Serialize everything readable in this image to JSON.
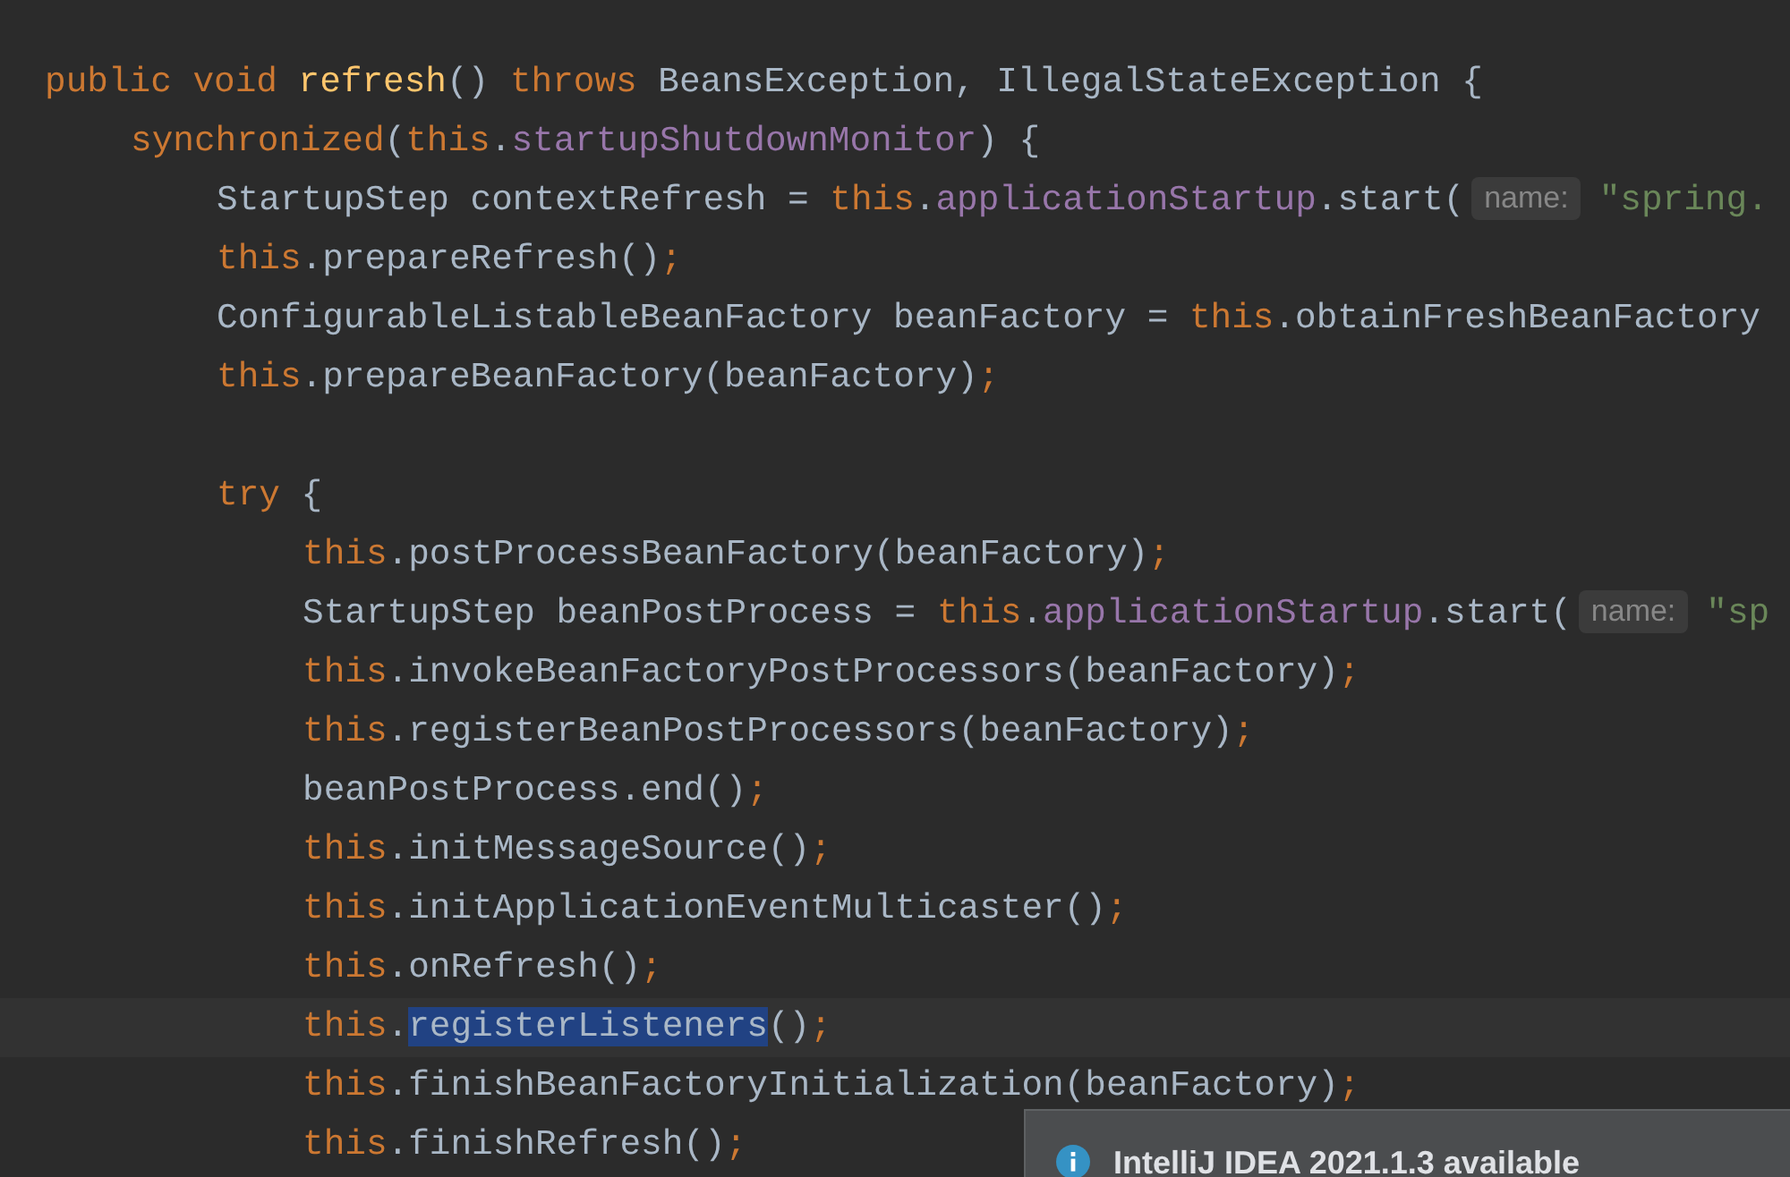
{
  "editor": {
    "lines": [
      {
        "kind": "code",
        "tokens": [
          {
            "kind": "kw",
            "text": "public void "
          },
          {
            "kind": "decl",
            "text": "refresh"
          },
          {
            "kind": "plain",
            "text": "() "
          },
          {
            "kind": "kw",
            "text": "throws"
          },
          {
            "kind": "plain",
            "text": " BeansException, IllegalStateException {"
          }
        ],
        "children": [
          {
            "kind": "code",
            "tokens": [
              {
                "kind": "kw",
                "text": "synchronized"
              },
              {
                "kind": "plain",
                "text": "("
              },
              {
                "kind": "kw",
                "text": "this"
              },
              {
                "kind": "plain",
                "text": "."
              },
              {
                "kind": "field",
                "text": "startupShutdownMonitor"
              },
              {
                "kind": "plain",
                "text": ") {"
              }
            ],
            "children": [
              {
                "kind": "code",
                "tokens": [
                  {
                    "kind": "plain",
                    "text": "StartupStep contextRefresh = "
                  },
                  {
                    "kind": "kw",
                    "text": "this"
                  },
                  {
                    "kind": "plain",
                    "text": "."
                  },
                  {
                    "kind": "field",
                    "text": "applicationStartup"
                  },
                  {
                    "kind": "plain",
                    "text": ".start("
                  },
                  {
                    "kind": "hint",
                    "text": "name:"
                  },
                  {
                    "kind": "str",
                    "text": "\"spring."
                  }
                ]
              },
              {
                "kind": "code",
                "tokens": [
                  {
                    "kind": "kw",
                    "text": "this"
                  },
                  {
                    "kind": "plain",
                    "text": ".prepareRefresh()"
                  },
                  {
                    "kind": "semi",
                    "text": ";"
                  }
                ]
              },
              {
                "kind": "code",
                "tokens": [
                  {
                    "kind": "plain",
                    "text": "ConfigurableListableBeanFactory beanFactory = "
                  },
                  {
                    "kind": "kw",
                    "text": "this"
                  },
                  {
                    "kind": "plain",
                    "text": ".obtainFreshBeanFactory"
                  }
                ]
              },
              {
                "kind": "code",
                "tokens": [
                  {
                    "kind": "kw",
                    "text": "this"
                  },
                  {
                    "kind": "plain",
                    "text": ".prepareBeanFactory(beanFactory)"
                  },
                  {
                    "kind": "semi",
                    "text": ";"
                  }
                ]
              },
              {
                "kind": "blank"
              },
              {
                "kind": "code",
                "tokens": [
                  {
                    "kind": "kw",
                    "text": "try"
                  },
                  {
                    "kind": "plain",
                    "text": " {"
                  }
                ],
                "children": [
                  {
                    "kind": "code",
                    "tokens": [
                      {
                        "kind": "kw",
                        "text": "this"
                      },
                      {
                        "kind": "plain",
                        "text": ".postProcessBeanFactory(beanFactory)"
                      },
                      {
                        "kind": "semi",
                        "text": ";"
                      }
                    ]
                  },
                  {
                    "kind": "code",
                    "tokens": [
                      {
                        "kind": "plain",
                        "text": "StartupStep beanPostProcess = "
                      },
                      {
                        "kind": "kw",
                        "text": "this"
                      },
                      {
                        "kind": "plain",
                        "text": "."
                      },
                      {
                        "kind": "field",
                        "text": "applicationStartup"
                      },
                      {
                        "kind": "plain",
                        "text": ".start("
                      },
                      {
                        "kind": "hint",
                        "text": "name:"
                      },
                      {
                        "kind": "str",
                        "text": "\"sp"
                      }
                    ]
                  },
                  {
                    "kind": "code",
                    "tokens": [
                      {
                        "kind": "kw",
                        "text": "this"
                      },
                      {
                        "kind": "plain",
                        "text": ".invokeBeanFactoryPostProcessors(beanFactory)"
                      },
                      {
                        "kind": "semi",
                        "text": ";"
                      }
                    ]
                  },
                  {
                    "kind": "code",
                    "tokens": [
                      {
                        "kind": "kw",
                        "text": "this"
                      },
                      {
                        "kind": "plain",
                        "text": ".registerBeanPostProcessors(beanFactory)"
                      },
                      {
                        "kind": "semi",
                        "text": ";"
                      }
                    ]
                  },
                  {
                    "kind": "code",
                    "tokens": [
                      {
                        "kind": "plain",
                        "text": "beanPostProcess.end()"
                      },
                      {
                        "kind": "semi",
                        "text": ";"
                      }
                    ]
                  },
                  {
                    "kind": "code",
                    "tokens": [
                      {
                        "kind": "kw",
                        "text": "this"
                      },
                      {
                        "kind": "plain",
                        "text": ".initMessageSource()"
                      },
                      {
                        "kind": "semi",
                        "text": ";"
                      }
                    ]
                  },
                  {
                    "kind": "code",
                    "tokens": [
                      {
                        "kind": "kw",
                        "text": "this"
                      },
                      {
                        "kind": "plain",
                        "text": ".initApplicationEventMulticaster()"
                      },
                      {
                        "kind": "semi",
                        "text": ";"
                      }
                    ]
                  },
                  {
                    "kind": "code",
                    "tokens": [
                      {
                        "kind": "kw",
                        "text": "this"
                      },
                      {
                        "kind": "plain",
                        "text": ".onRefresh()"
                      },
                      {
                        "kind": "semi",
                        "text": ";"
                      }
                    ]
                  },
                  {
                    "kind": "caret",
                    "tokens": [
                      {
                        "kind": "kw",
                        "text": "this"
                      },
                      {
                        "kind": "plain",
                        "text": "."
                      },
                      {
                        "kind": "sel",
                        "text": "registerListeners"
                      },
                      {
                        "kind": "plain",
                        "text": "()"
                      },
                      {
                        "kind": "semi",
                        "text": ";"
                      }
                    ]
                  },
                  {
                    "kind": "code",
                    "tokens": [
                      {
                        "kind": "kw",
                        "text": "this"
                      },
                      {
                        "kind": "plain",
                        "text": ".finishBeanFactoryInitialization(beanFactory)"
                      },
                      {
                        "kind": "semi",
                        "text": ";"
                      }
                    ]
                  },
                  {
                    "kind": "code",
                    "tokens": [
                      {
                        "kind": "kw",
                        "text": "this"
                      },
                      {
                        "kind": "plain",
                        "text": ".finishRefresh()"
                      },
                      {
                        "kind": "semi",
                        "text": ";"
                      }
                    ]
                  }
                ]
              }
            ]
          }
        ]
      }
    ]
  },
  "notification": {
    "title": "IntelliJ IDEA 2021.1.3 available"
  }
}
